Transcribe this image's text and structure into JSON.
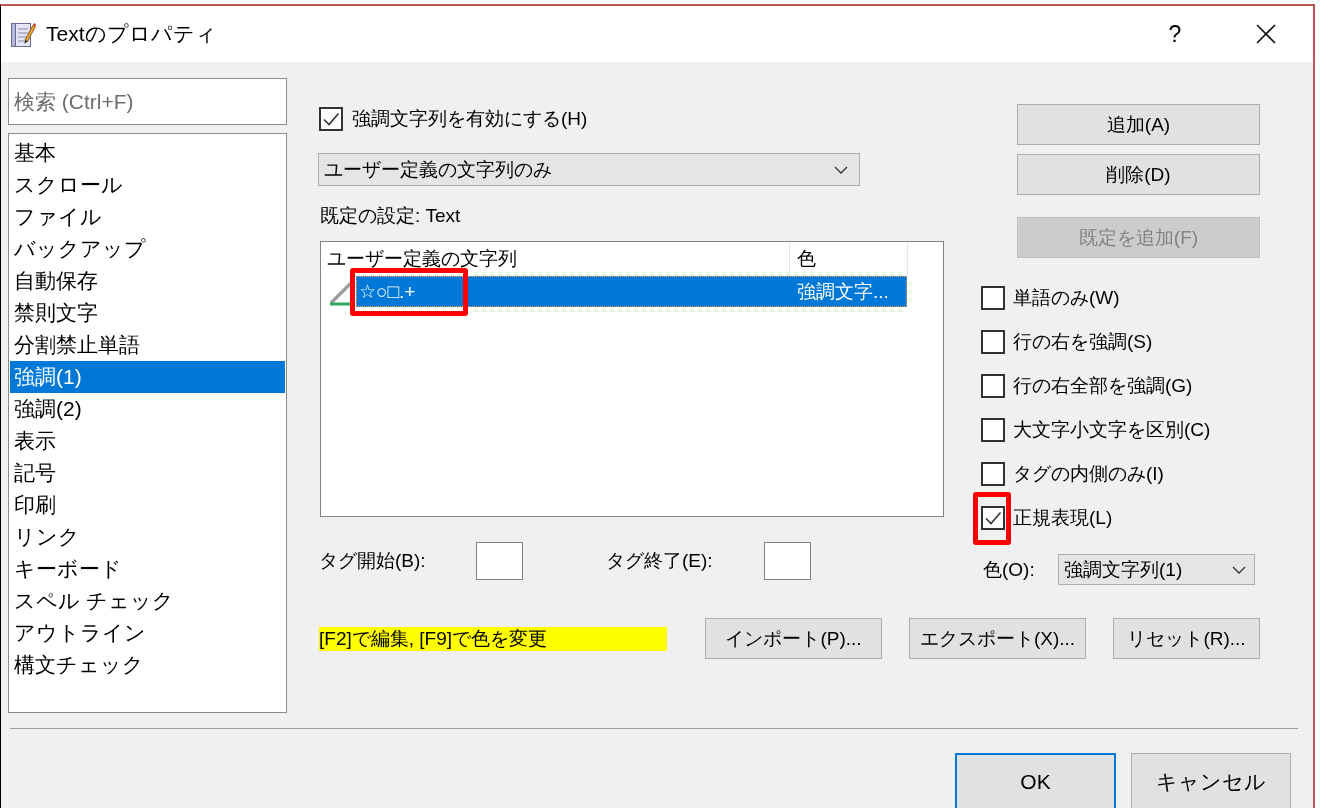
{
  "window": {
    "title": "Textのプロパティ",
    "help": "?"
  },
  "search": {
    "placeholder": "検索 (Ctrl+F)"
  },
  "categories": [
    {
      "label": "基本",
      "selected": false
    },
    {
      "label": "スクロール",
      "selected": false
    },
    {
      "label": "ファイル",
      "selected": false
    },
    {
      "label": "バックアップ",
      "selected": false
    },
    {
      "label": "自動保存",
      "selected": false
    },
    {
      "label": "禁則文字",
      "selected": false
    },
    {
      "label": "分割禁止単語",
      "selected": false
    },
    {
      "label": "強調(1)",
      "selected": true
    },
    {
      "label": "強調(2)",
      "selected": false
    },
    {
      "label": "表示",
      "selected": false
    },
    {
      "label": "記号",
      "selected": false
    },
    {
      "label": "印刷",
      "selected": false
    },
    {
      "label": "リンク",
      "selected": false
    },
    {
      "label": "キーボード",
      "selected": false
    },
    {
      "label": "スペル チェック",
      "selected": false
    },
    {
      "label": "アウトライン",
      "selected": false
    },
    {
      "label": "構文チェック",
      "selected": false
    }
  ],
  "enable_highlight": {
    "label": "強調文字列を有効にする(H)",
    "checked": true
  },
  "mode_dropdown": {
    "value": "ユーザー定義の文字列のみ"
  },
  "default_setting": "既定の設定: Text",
  "table": {
    "columns": [
      "ユーザー定義の文字列",
      "色"
    ],
    "rows": [
      {
        "cells": [
          "☆○□.+",
          "強調文字..."
        ],
        "selected": true,
        "highlighted": true
      }
    ]
  },
  "tag_start": {
    "label": "タグ開始(B):"
  },
  "tag_end": {
    "label": "タグ終了(E):"
  },
  "side_buttons": [
    {
      "label": "追加(A)",
      "disabled": false
    },
    {
      "label": "削除(D)",
      "disabled": false
    },
    {
      "label": "既定を追加(F)",
      "disabled": true
    }
  ],
  "options": [
    {
      "label": "単語のみ(W)",
      "checked": false,
      "highlighted": false
    },
    {
      "label": "行の右を強調(S)",
      "checked": false,
      "highlighted": false
    },
    {
      "label": "行の右全部を強調(G)",
      "checked": false,
      "highlighted": false
    },
    {
      "label": "大文字小文字を区別(C)",
      "checked": false,
      "highlighted": false
    },
    {
      "label": "タグの内側のみ(I)",
      "checked": false,
      "highlighted": false
    },
    {
      "label": "正規表現(L)",
      "checked": true,
      "highlighted": true
    }
  ],
  "color_dropdown": {
    "label": "色(O):",
    "value": "強調文字列(1)"
  },
  "hint": "[F2]で編集, [F9]で色を変更",
  "file_buttons": [
    {
      "label": "インポート(P)..."
    },
    {
      "label": "エクスポート(X)..."
    },
    {
      "label": "リセット(R)..."
    }
  ],
  "dialog_buttons": [
    {
      "label": "OK",
      "default": true
    },
    {
      "label": "キャンセル",
      "default": false
    }
  ]
}
